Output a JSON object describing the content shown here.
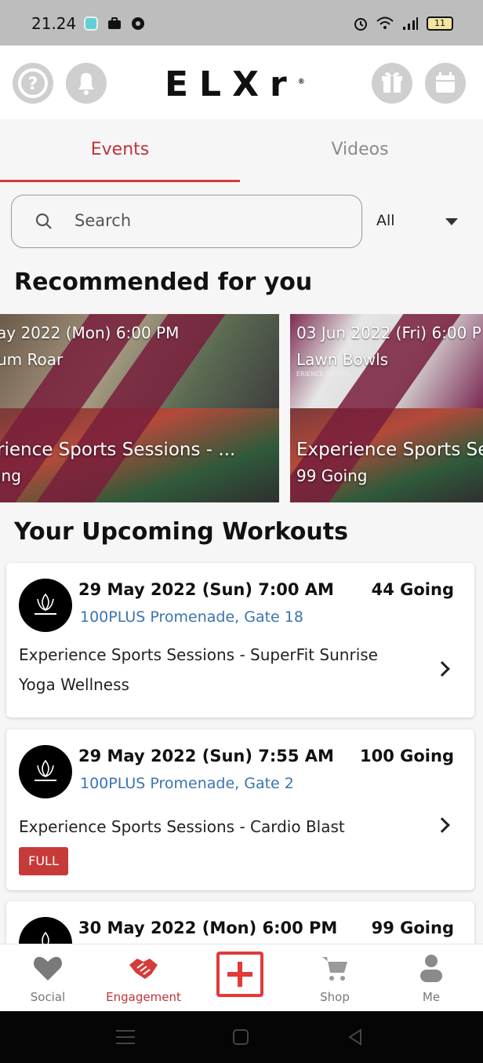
{
  "status_bar": {
    "time": "21.24",
    "battery": "11"
  },
  "header": {
    "logo": "ELXr",
    "logo_mark": "®"
  },
  "tabs": [
    {
      "label": "Events",
      "active": true
    },
    {
      "label": "Videos",
      "active": false
    }
  ],
  "search": {
    "placeholder": "Search",
    "filter_value": "All"
  },
  "sections": {
    "recommended": "Recommended for you",
    "upcoming": "Your Upcoming Workouts"
  },
  "recommended": [
    {
      "date": "ay 2022 (Mon) 6:00 PM",
      "venue": "um Roar",
      "title": "rience Sports Sessions -  ...",
      "going": "ing",
      "sub": ""
    },
    {
      "date": "03 Jun 2022 (Fri) 6:00 P",
      "venue": "Lawn Bowls",
      "title": "Experience Sports Se",
      "going": "99 Going",
      "sub": "ERIENCE SPORTS"
    }
  ],
  "workouts": [
    {
      "date": "29 May 2022 (Sun) 7:00 AM",
      "going": "44 Going",
      "location": "100PLUS Promenade, Gate 18",
      "title": "Experience Sports Sessions -  SuperFit Sunrise Yoga Wellness",
      "badge": ""
    },
    {
      "date": "29 May 2022 (Sun) 7:55 AM",
      "going": "100 Going",
      "location": "100PLUS Promenade, Gate 2",
      "title": "Experience Sports Sessions -  Cardio Blast",
      "badge": "FULL"
    },
    {
      "date": "30 May 2022 (Mon) 6:00 PM",
      "going": "99 Going",
      "location": "",
      "title": "",
      "badge": ""
    }
  ],
  "bottom_nav": [
    {
      "label": "Social",
      "icon": "heart-icon",
      "active": false
    },
    {
      "label": "Engagement",
      "icon": "handshake-icon",
      "active": true
    },
    {
      "label": "",
      "icon": "add-icon",
      "active": false
    },
    {
      "label": "Shop",
      "icon": "cart-icon",
      "active": false
    },
    {
      "label": "Me",
      "icon": "person-icon",
      "active": false
    }
  ],
  "colors": {
    "accent": "#c0333a",
    "link": "#3b74b0",
    "badge": "#c73a3a"
  }
}
